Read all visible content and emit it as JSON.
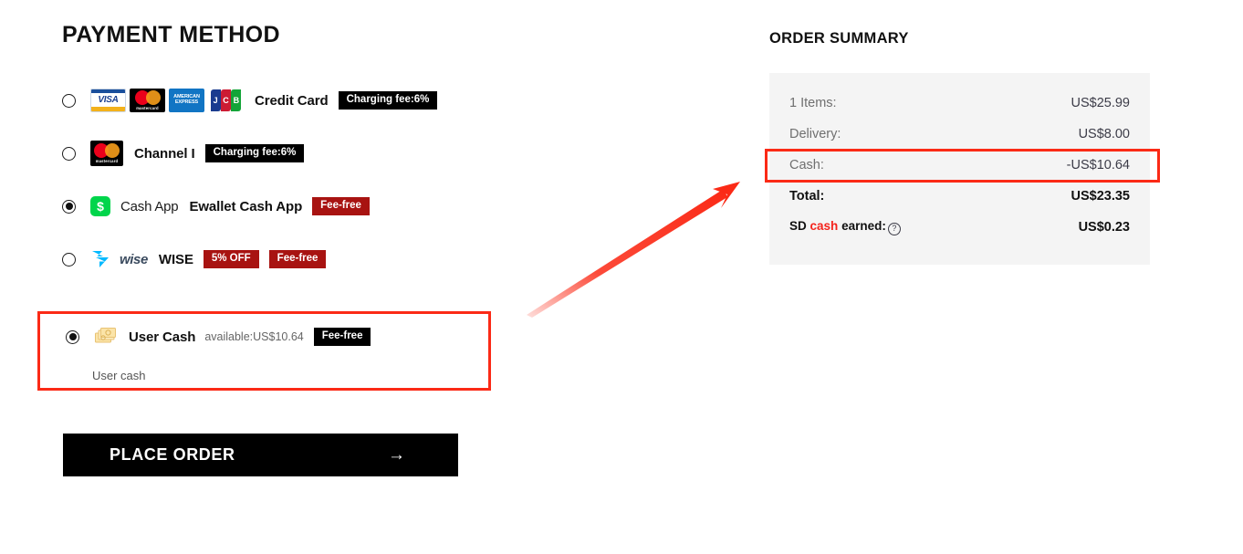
{
  "payment": {
    "title": "PAYMENT METHOD",
    "methods": [
      {
        "id": "credit-card",
        "name": "Credit Card",
        "selected": false,
        "badge": "Charging fee:6%",
        "badge_style": "black",
        "logos": [
          "visa-logo",
          "mastercard-logo",
          "american-express-logo",
          "jcb-logo"
        ],
        "logo_labels": {
          "visa": "VISA",
          "mastercard": "mastercard",
          "amex_line1": "AMERICAN",
          "amex_line2": "EXPRESS",
          "jcb_j": "J",
          "jcb_c": "C",
          "jcb_b": "B"
        }
      },
      {
        "id": "channel-1",
        "name": "Channel I",
        "selected": false,
        "badge": "Charging fee:6%",
        "badge_style": "black",
        "logos": [
          "mastercard-logo"
        ]
      },
      {
        "id": "cash-app",
        "name": "Ewallet Cash App",
        "brand_word": "Cash App",
        "brand_glyph": "$",
        "selected": true,
        "badge": "Fee-free",
        "badge_style": "red",
        "logos": [
          "cash-app-logo"
        ]
      },
      {
        "id": "wise",
        "name": "WISE",
        "brand_word": "wise",
        "selected": false,
        "badges": [
          "5% OFF",
          "Fee-free"
        ],
        "badge_style": "red",
        "logos": [
          "wise-logo"
        ]
      }
    ],
    "user_cash": {
      "id": "user-cash",
      "name": "User Cash",
      "selected": true,
      "available_note": "available:US$10.64",
      "badge": "Fee-free",
      "badge_style": "black",
      "description": "User cash"
    },
    "place_order": {
      "label": "PLACE ORDER",
      "arrow": "→"
    }
  },
  "summary": {
    "title": "ORDER SUMMARY",
    "rows": [
      {
        "label": "1 Items:",
        "value": "US$25.99",
        "bold": false
      },
      {
        "label": "Delivery:",
        "value": "US$8.00",
        "bold": false
      },
      {
        "label": "Cash:",
        "value": "-US$10.64",
        "bold": false,
        "highlighted": true
      },
      {
        "label": "Total:",
        "value": "US$23.35",
        "bold": true
      }
    ],
    "sd_cash": {
      "prefix": "SD",
      "highlight_word": "cash",
      "suffix": "earned:",
      "info_icon": "question-mark-icon",
      "value": "US$0.23"
    }
  },
  "annotations": {
    "arrow_color": "#fb2a16",
    "highlight_color": "#fb2a16"
  }
}
